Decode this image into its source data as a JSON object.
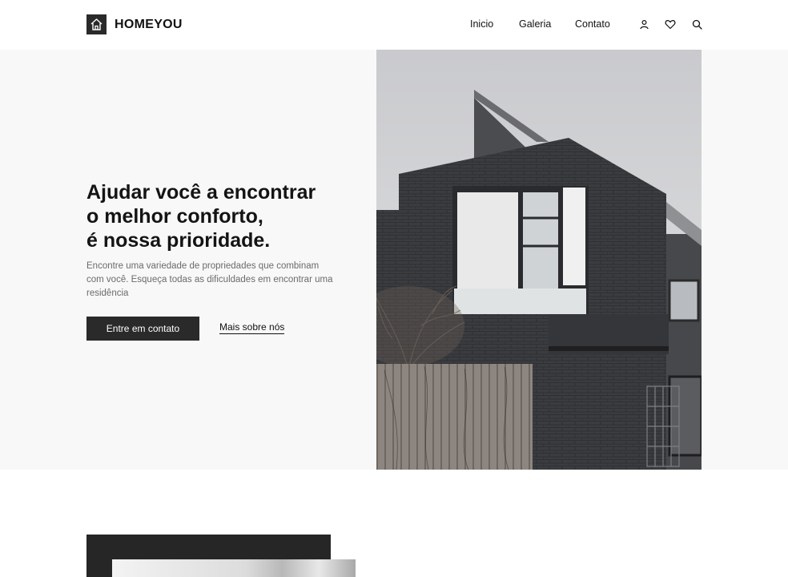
{
  "brand": {
    "name": "HOMEYOU",
    "logo_icon": "house-icon"
  },
  "nav": {
    "items": [
      {
        "label": "Inicio"
      },
      {
        "label": "Galeria"
      },
      {
        "label": "Contato"
      }
    ],
    "icons": [
      "user-icon",
      "heart-icon",
      "search-icon"
    ]
  },
  "hero": {
    "title_lines": [
      "Ajudar você a encontrar",
      "o melhor conforto,",
      "é nossa prioridade."
    ],
    "description": "Encontre uma variedade de propriedades que combinam com você. Esqueça todas as dificuldades em encontrar uma residência",
    "primary_button": "Entre em contato",
    "secondary_link": "Mais sobre nós",
    "image_subject": "modern dark brick house"
  },
  "colors": {
    "accent": "#2a2a2a",
    "hero_background": "#f8f8f8",
    "text_muted": "#6b6b6b"
  }
}
